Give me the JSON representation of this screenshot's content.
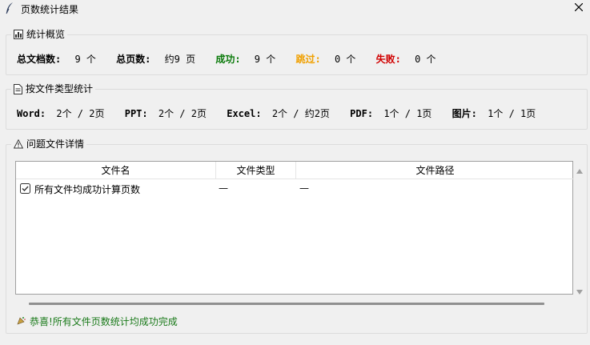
{
  "window": {
    "title": "页数统计结果"
  },
  "overview": {
    "heading": "统计概览",
    "total_docs_label": "总文档数:",
    "total_docs_value": "9 个",
    "total_pages_label": "总页数:",
    "total_pages_value": "约9 页",
    "success_label": "成功:",
    "success_value": "9 个",
    "skipped_label": "跳过:",
    "skipped_value": "0 个",
    "failed_label": "失败:",
    "failed_value": "0 个",
    "colors": {
      "success": "#0a7a0a",
      "skipped": "#f0a000",
      "failed": "#d00000"
    }
  },
  "by_type": {
    "heading": "按文件类型统计",
    "items": [
      {
        "label": "Word:",
        "value": "2个 / 2页"
      },
      {
        "label": "PPT:",
        "value": "2个 / 2页"
      },
      {
        "label": "Excel:",
        "value": "2个 / 约2页"
      },
      {
        "label": "PDF:",
        "value": "1个 / 1页"
      },
      {
        "label": "图片:",
        "value": "1个 / 1页"
      }
    ]
  },
  "issues": {
    "heading": "问题文件详情",
    "columns": [
      "文件名",
      "文件类型",
      "文件路径"
    ],
    "rows": [
      {
        "name": "所有文件均成功计算页数",
        "type": "—",
        "path": "—"
      }
    ],
    "footer": "恭喜!所有文件页数统计均成功完成"
  }
}
